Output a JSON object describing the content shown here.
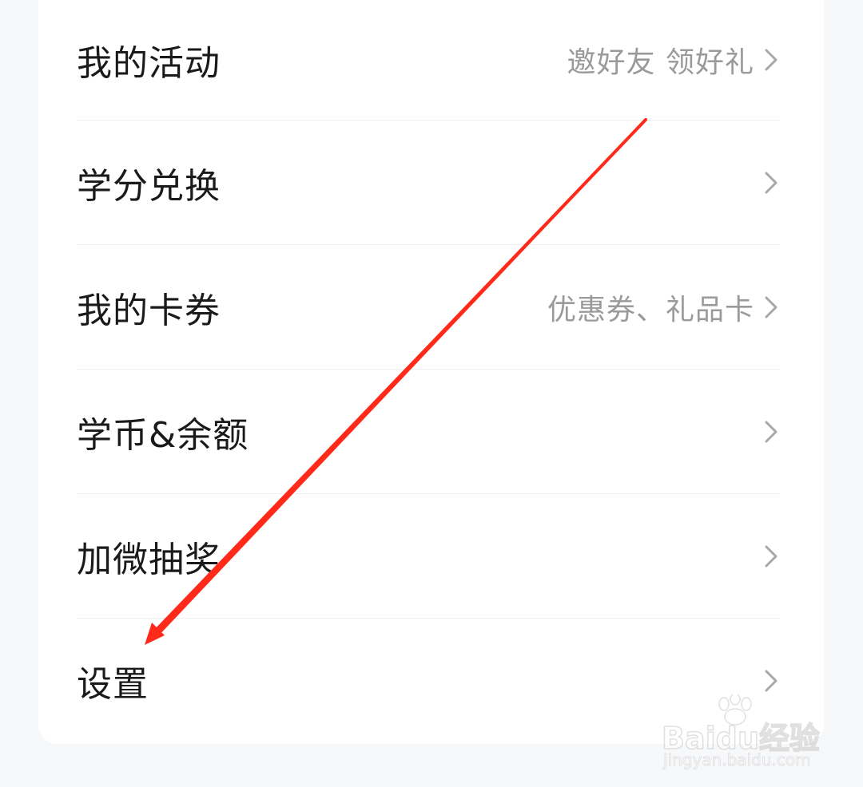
{
  "menu": {
    "items": [
      {
        "label": "我的活动",
        "sub": "邀好友 领好礼"
      },
      {
        "label": "学分兑换",
        "sub": ""
      },
      {
        "label": "我的卡券",
        "sub": "优惠券、礼品卡"
      },
      {
        "label": "学币&余额",
        "sub": ""
      },
      {
        "label": "加微抽奖",
        "sub": ""
      },
      {
        "label": "设置",
        "sub": ""
      }
    ]
  },
  "icons": {
    "chevron": "chevron-right-icon",
    "annotation": "red-arrow-annotation"
  },
  "colors": {
    "background": "#f7f8fa",
    "card": "#ffffff",
    "label_text": "#1a1a1a",
    "sub_text": "#9a9a9a",
    "chevron": "#a8a8a8",
    "annotation_arrow": "#ff2a1a"
  },
  "watermark": {
    "logo_text": "Baidu经验",
    "url_text": "jingyan.baidu.com"
  }
}
